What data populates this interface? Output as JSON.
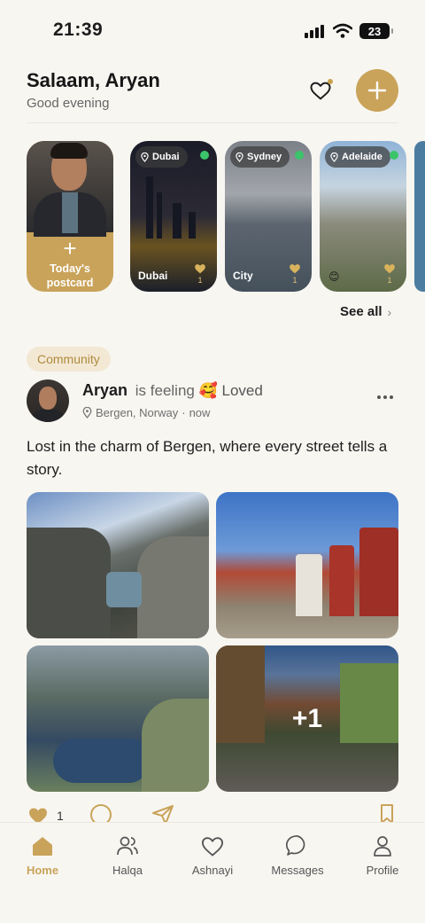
{
  "status_bar": {
    "time": "21:39",
    "battery": "23"
  },
  "header": {
    "greeting": "Salaam, Aryan",
    "subtitle": "Good evening"
  },
  "stories": {
    "postcard_label": "Today's postcard",
    "cards": [
      {
        "location": "Dubai",
        "caption": "Dubai",
        "likes": "1"
      },
      {
        "location": "Sydney",
        "caption": "City",
        "likes": "1"
      },
      {
        "location": "Adelaide",
        "emoji": "😊",
        "likes": "1"
      }
    ],
    "see_all": "See all"
  },
  "post": {
    "tag": "Community",
    "author": "Aryan",
    "feeling_prefix": "is feeling",
    "mood_emoji": "🥰",
    "mood": "Loved",
    "location": "Bergen, Norway",
    "time": "now",
    "caption": "Lost in the charm of Bergen, where every street tells a story.",
    "extra_photos": "+1",
    "like_count": "1"
  },
  "tabs": [
    {
      "label": "Home",
      "icon": "home-icon"
    },
    {
      "label": "Halqa",
      "icon": "people-icon"
    },
    {
      "label": "Ashnayi",
      "icon": "heart-icon"
    },
    {
      "label": "Messages",
      "icon": "chat-icon"
    },
    {
      "label": "Profile",
      "icon": "person-icon"
    }
  ],
  "colors": {
    "accent": "#c9a35a",
    "background": "#f8f6f1",
    "online": "#3bc46a",
    "tag_bg": "#f2e8d4"
  }
}
